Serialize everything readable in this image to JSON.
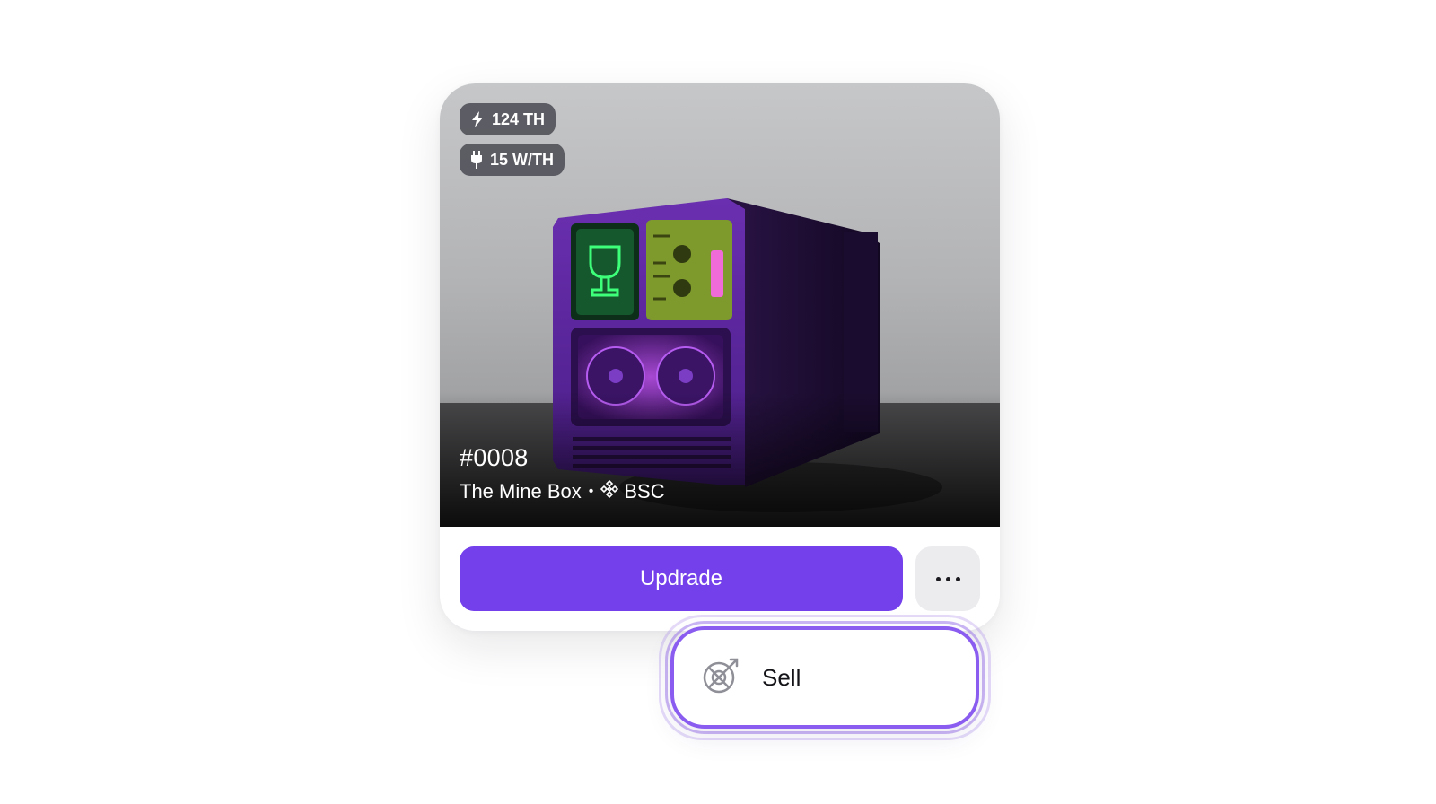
{
  "card": {
    "badges": [
      {
        "icon": "lightning-icon",
        "label": "124 TH"
      },
      {
        "icon": "plug-icon",
        "label": "15 W/TH"
      }
    ],
    "nft_id": "#0008",
    "collection": "The Mine Box",
    "separator": "•",
    "chain_icon": "bnb-chain-icon",
    "chain": "BSC",
    "primary_button": "Updrade",
    "more_button_icon": "more-horizontal-icon"
  },
  "dropdown": {
    "items": [
      {
        "icon": "sell-icon",
        "label": "Sell"
      }
    ]
  },
  "colors": {
    "primary": "#7340ec",
    "more_button_bg": "#ececef",
    "highlight_border": "#8a5cf0"
  }
}
